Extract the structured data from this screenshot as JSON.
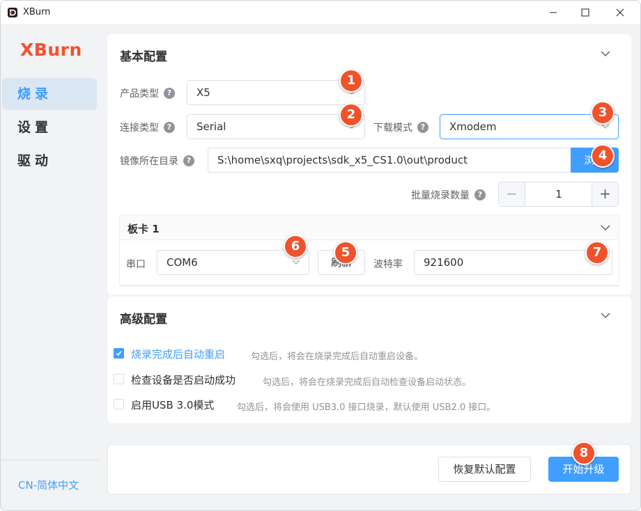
{
  "window": {
    "title": "XBurn"
  },
  "sidebar": {
    "brand": "XBurn",
    "items": [
      {
        "label": "烧录",
        "active": true
      },
      {
        "label": "设置",
        "active": false
      },
      {
        "label": "驱动",
        "active": false
      }
    ],
    "language": "CN-简体中文"
  },
  "basic": {
    "title": "基本配置",
    "product_type": {
      "label": "产品类型",
      "value": "X5"
    },
    "connection_type": {
      "label": "连接类型",
      "value": "Serial"
    },
    "download_mode": {
      "label": "下载模式",
      "value": "Xmodem"
    },
    "image_dir": {
      "label": "镜像所在目录",
      "value": "S:\\home\\sxq\\projects\\sdk_x5_CS1.0\\out\\product",
      "browse_label": "浏览"
    },
    "batch": {
      "label": "批量烧录数量",
      "value": "1",
      "dec": "−",
      "inc": "+"
    },
    "board": {
      "title": "板卡 1",
      "port_label": "串口",
      "port_value": "COM6",
      "refresh_label": "刷新",
      "baud_label": "波特率",
      "baud_value": "921600"
    }
  },
  "advanced": {
    "title": "高级配置",
    "options": [
      {
        "label": "烧录完成后自动重启",
        "desc": "勾选后，将会在烧录完成后自动重启设备。",
        "checked": true
      },
      {
        "label": "检查设备是否启动成功",
        "desc": "勾选后，将会在烧录完成后自动检查设备启动状态。",
        "checked": false
      },
      {
        "label": "启用USB 3.0模式",
        "desc": "勾选后，将会使用 USB3.0 接口烧录，默认使用 USB2.0 接口。",
        "checked": false
      }
    ]
  },
  "footer": {
    "reset_label": "恢复默认配置",
    "start_label": "开始升级"
  },
  "badges": [
    "1",
    "2",
    "3",
    "4",
    "5",
    "6",
    "7",
    "8"
  ],
  "colors": {
    "accent": "#409eff",
    "brand": "#f5502d",
    "badge": "#f0522b"
  }
}
